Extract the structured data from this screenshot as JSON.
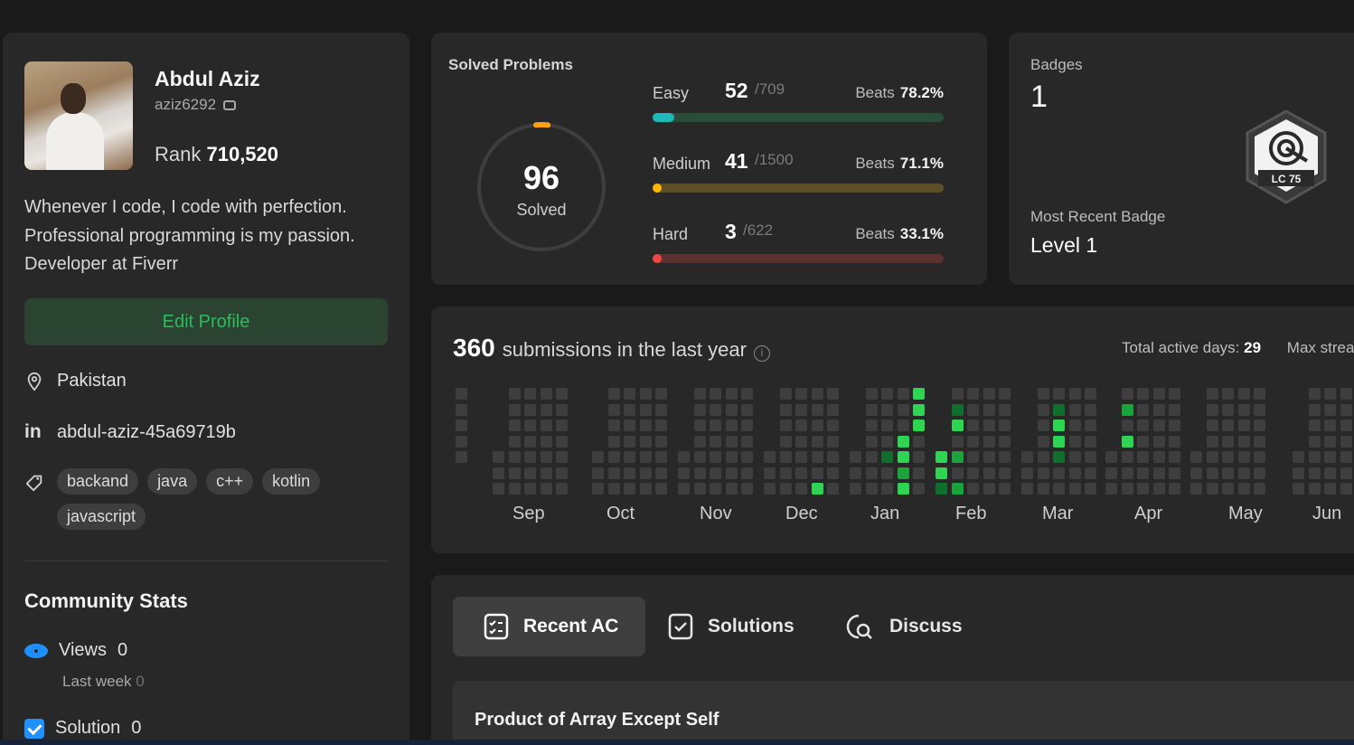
{
  "profile": {
    "name": "Abdul Aziz",
    "username": "aziz6292",
    "rank_label": "Rank",
    "rank_value": "710,520",
    "bio": "Whenever I code, I code with perfection. Professional programming is my passion. Developer at Fiverr",
    "edit_button": "Edit Profile",
    "location": "Pakistan",
    "linkedin": "abdul-aziz-45a69719b",
    "skills": [
      "backand",
      "java",
      "c++",
      "kotlin",
      "javascript"
    ],
    "community_title": "Community Stats",
    "views_label": "Views",
    "views_value": "0",
    "last_week_label": "Last week",
    "last_week_value": "0",
    "solution_label": "Solution",
    "solution_value": "0",
    "icons": {
      "location": "map-pin-icon",
      "linkedin": "linkedin-icon",
      "skills": "tag-icon",
      "views": "eye-icon",
      "solution": "checkbox-icon",
      "username": "camera-icon"
    }
  },
  "solved": {
    "title": "Solved Problems",
    "total": "96",
    "total_label": "Solved",
    "difficulties": [
      {
        "label": "Easy",
        "solved": "52",
        "total": "/709",
        "beats_label": "Beats",
        "beats": "78.2%",
        "ratio": 0.0733,
        "color": "#1cbaba",
        "track": "#2a4d3a"
      },
      {
        "label": "Medium",
        "solved": "41",
        "total": "/1500",
        "beats_label": "Beats",
        "beats": "71.1%",
        "ratio": 0.0273,
        "color": "#ffb700",
        "track": "#5d4f25"
      },
      {
        "label": "Hard",
        "solved": "3",
        "total": "/622",
        "beats_label": "Beats",
        "beats": "33.1%",
        "ratio": 0.0048,
        "color": "#ef4743",
        "track": "#5e3131"
      }
    ],
    "ring_fraction": 0.0305,
    "ring_color": "#ffa116"
  },
  "badges": {
    "title": "Badges",
    "count": "1",
    "recent_label": "Most Recent Badge",
    "recent_value": "Level 1",
    "badge_text": "LC 75",
    "badge_icon": "target-badge-icon"
  },
  "heatmap": {
    "count": "360",
    "title": "submissions in the last year",
    "active_label": "Total active days:",
    "active_value": "29",
    "max_label": "Max strea",
    "months": [
      "Sep",
      "Oct",
      "Nov",
      "Dec",
      "Jan",
      "Feb",
      "Mar",
      "Apr",
      "May",
      "Jun"
    ],
    "colors": {
      "empty": "#3e3e3e",
      "low": "#106f2c",
      "mid": "#1ba33c",
      "high": "#2ed552"
    }
  },
  "recent": {
    "tabs": [
      {
        "label": "Recent AC",
        "icon": "list-check-icon",
        "active": true
      },
      {
        "label": "Solutions",
        "icon": "square-check-icon",
        "active": false
      },
      {
        "label": "Discuss",
        "icon": "discuss-icon",
        "active": false
      }
    ],
    "items": [
      "Product of Array Except Self"
    ]
  }
}
